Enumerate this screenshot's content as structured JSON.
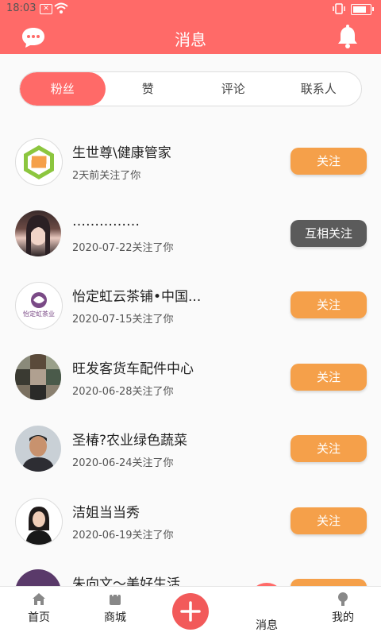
{
  "status_bar": {
    "time": "18:03",
    "notif_box": "✕"
  },
  "header": {
    "title": "消息"
  },
  "tabs": [
    {
      "label": "粉丝",
      "active": true
    },
    {
      "label": "赞",
      "active": false
    },
    {
      "label": "评论",
      "active": false
    },
    {
      "label": "联系人",
      "active": false
    }
  ],
  "followers": [
    {
      "name": "生世尊\\健康管家",
      "time": "2天前关注了你",
      "button": "关注"
    },
    {
      "name": "……………",
      "time": "2020-07-22关注了你",
      "button": "互相关注"
    },
    {
      "name": "怡定虹云茶铺•中国...",
      "time": "2020-07-15关注了你",
      "button": "关注"
    },
    {
      "name": "旺发客货车配件中心",
      "time": "2020-06-28关注了你",
      "button": "关注"
    },
    {
      "name": "圣椿?农业绿色蔬菜",
      "time": "2020-06-24关注了你",
      "button": "关注"
    },
    {
      "name": "洁姐当当秀",
      "time": "2020-06-19关注了你",
      "button": "关注"
    },
    {
      "name": "朱向文～美好生活...",
      "time": "",
      "button": "关注"
    }
  ],
  "avatar3_text": "怡定虹茶业",
  "bottom_nav": {
    "home": "首页",
    "mall": "商城",
    "messages": "消息",
    "mine": "我的"
  },
  "colors": {
    "primary": "#ff6a68",
    "follow": "#f5a04a",
    "mutual": "#5b5b5b"
  }
}
